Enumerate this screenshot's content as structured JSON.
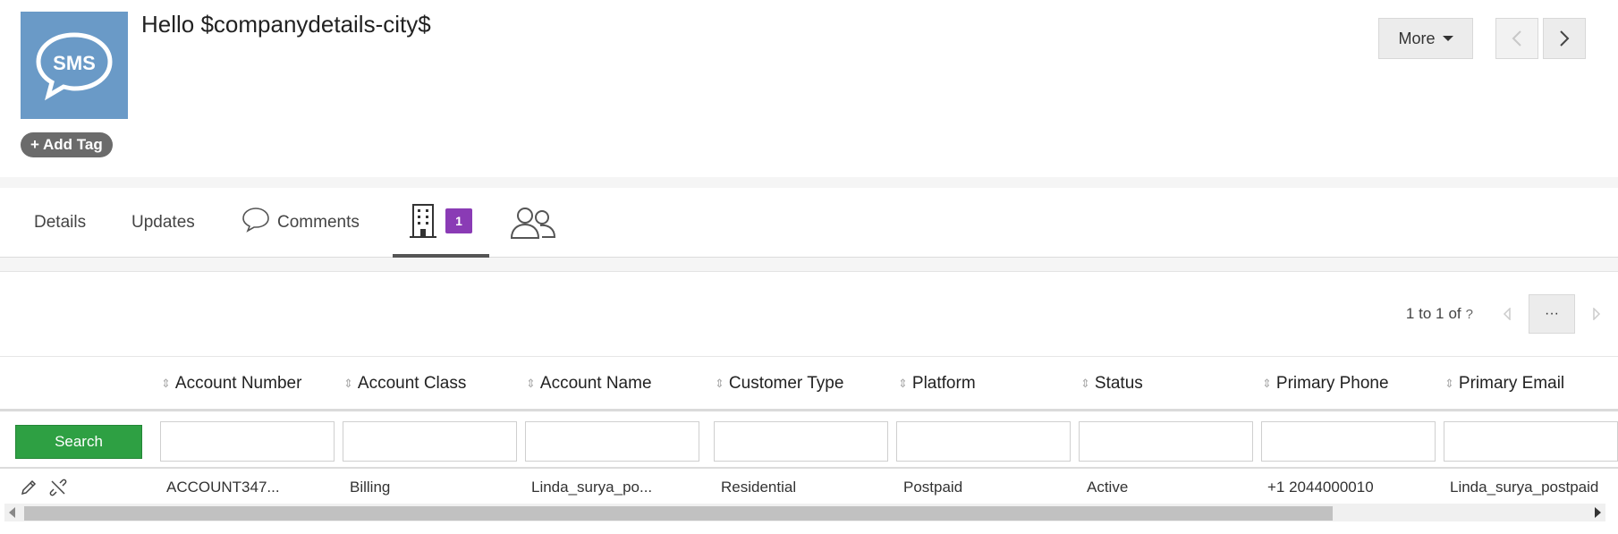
{
  "header": {
    "logo_text": "SMS",
    "title": "Hello $companydetails-city$",
    "add_tag_label": "+ Add Tag",
    "more_label": "More"
  },
  "tabs": [
    {
      "label": "Details"
    },
    {
      "label": "Updates"
    },
    {
      "label": "Comments"
    },
    {
      "label": "",
      "badge": "1",
      "icon": "building-icon",
      "active": true
    },
    {
      "label": "",
      "icon": "people-icon"
    }
  ],
  "pager": {
    "range": "1 to 1",
    "of_label": "of",
    "more_label": "···"
  },
  "grid": {
    "search_label": "Search",
    "columns": [
      "Account Number",
      "Account Class",
      "Account Name",
      "Customer Type",
      "Platform",
      "Status",
      "Primary Phone",
      "Primary Email"
    ],
    "rows": [
      [
        "ACCOUNT347...",
        "Billing",
        "Linda_surya_po...",
        "Residential",
        "Postpaid",
        "Active",
        "+1 2044000010",
        "Linda_surya_postpaid"
      ]
    ]
  },
  "colors": {
    "logo_bg": "#6a9ac7",
    "badge": "#8a3bb5",
    "search_button": "#2ea043"
  }
}
